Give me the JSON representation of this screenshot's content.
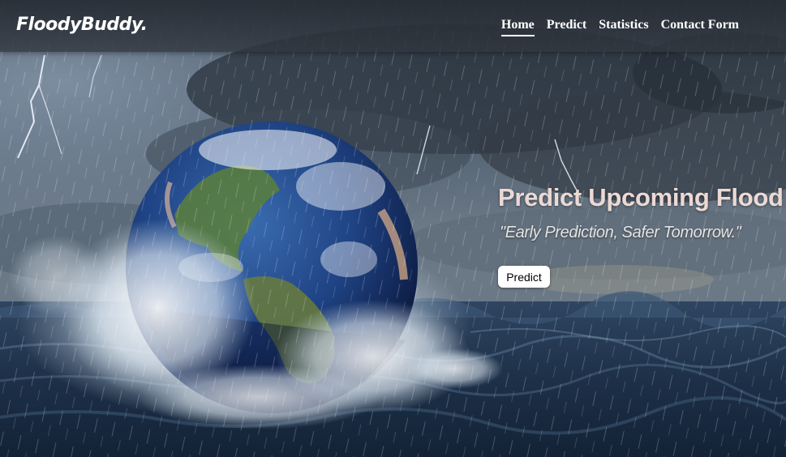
{
  "navbar": {
    "brand": "FloodyBuddy.",
    "links": [
      {
        "label": "Home",
        "active": true
      },
      {
        "label": "Predict",
        "active": false
      },
      {
        "label": "Statistics",
        "active": false
      },
      {
        "label": "Contact Form",
        "active": false
      }
    ]
  },
  "hero": {
    "title": "Predict Upcoming Flood",
    "tagline": "\"Early Prediction, Safer Tomorrow.\"",
    "button_label": "Predict",
    "background_image": "earth-in-stormy-sea"
  },
  "colors": {
    "navbar_bg": "#2c3238",
    "title_text": "#ecd9d4",
    "button_bg": "#ffffff",
    "sea": "#1b2c42",
    "sky": "#4a5866"
  }
}
